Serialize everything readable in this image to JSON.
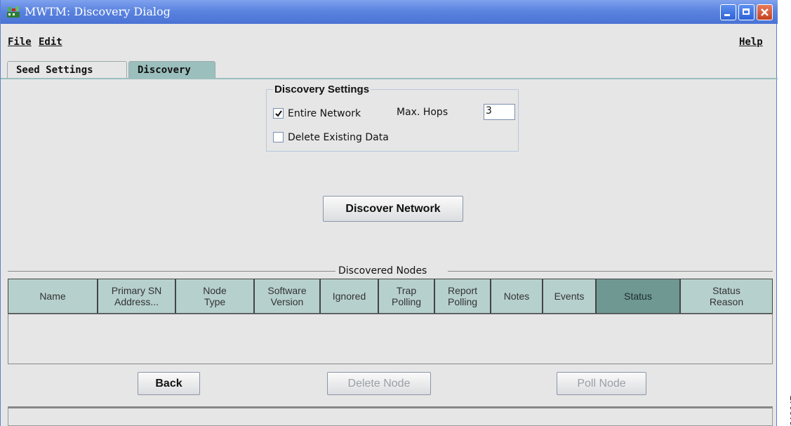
{
  "window": {
    "title": "MWTM: Discovery Dialog"
  },
  "menu": {
    "file": "File",
    "edit": "Edit",
    "help": "Help"
  },
  "tabs": [
    {
      "label": "Seed Settings"
    },
    {
      "label": "Discovery"
    }
  ],
  "discovery_settings": {
    "title": "Discovery Settings",
    "entire_network": {
      "label": "Entire Network",
      "checked": true
    },
    "max_hops_label": "Max. Hops",
    "max_hops_value": "3",
    "delete_existing": {
      "label": "Delete Existing Data",
      "checked": false
    }
  },
  "discover_button": "Discover Network",
  "discovered_nodes": {
    "title": "Discovered Nodes",
    "columns": [
      "Name",
      "Primary SN\nAddress...",
      "Node\nType",
      "Software\nVersion",
      "Ignored",
      "Trap\nPolling",
      "Report\nPolling",
      "Notes",
      "Events",
      "Status",
      "Status\nReason"
    ],
    "rows": []
  },
  "buttons": {
    "back": "Back",
    "delete_node": "Delete Node",
    "poll_node": "Poll Node"
  },
  "figure_code": "210647",
  "colors": {
    "titlebar": "#5b84e0",
    "tab_active": "#9bbfbd",
    "header": "#b6d0cd",
    "header_selected": "#6f9893"
  }
}
